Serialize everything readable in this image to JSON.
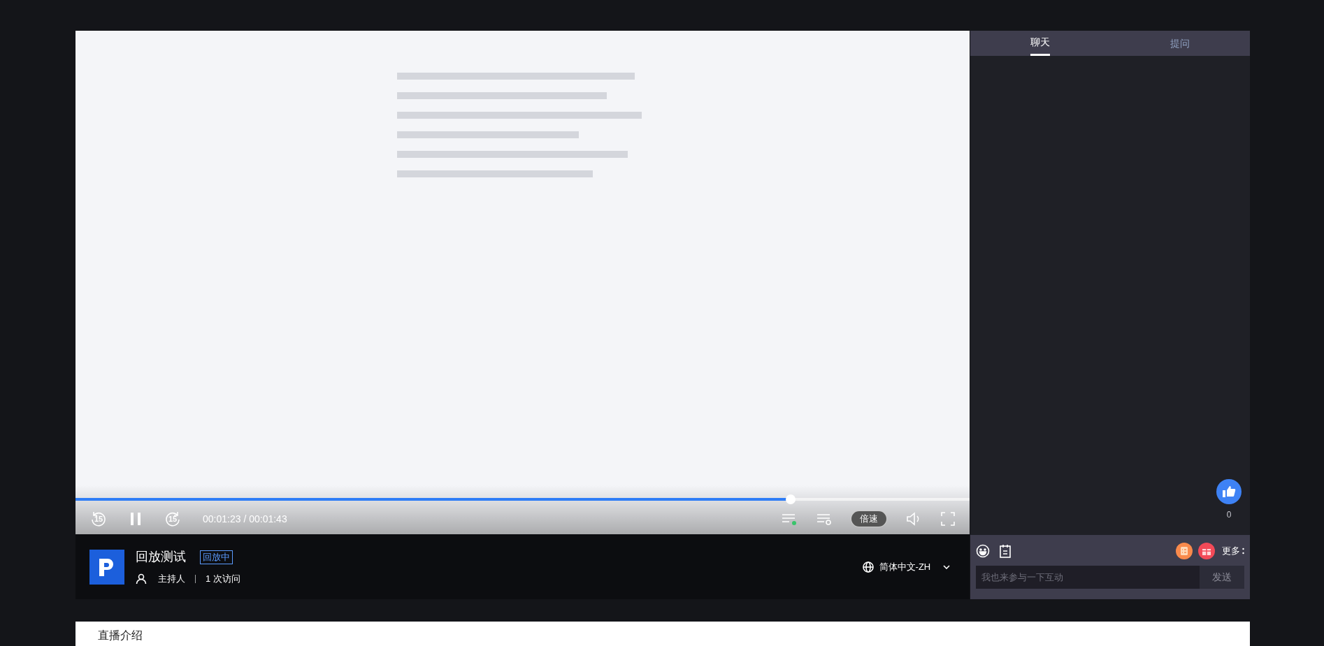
{
  "player": {
    "progress": {
      "level": 0.8
    },
    "playing": true,
    "time": "00:01:23 / 00:01:43",
    "rewind_label": "15",
    "forward_label": "15",
    "speed_button": "倍速"
  },
  "info": {
    "title": "回放测试",
    "badge": "回放中",
    "host": "主持人",
    "visits": "1 次访问",
    "language": "简体中文-ZH"
  },
  "side": {
    "tabs": [
      {
        "label": "聊天",
        "selected": true
      },
      {
        "label": "提问",
        "selected": false
      }
    ],
    "likes": "0",
    "more": "更多",
    "placeholder": "我也来参与一下互动",
    "send": "发送"
  },
  "intro": {
    "title": "直播介绍"
  }
}
